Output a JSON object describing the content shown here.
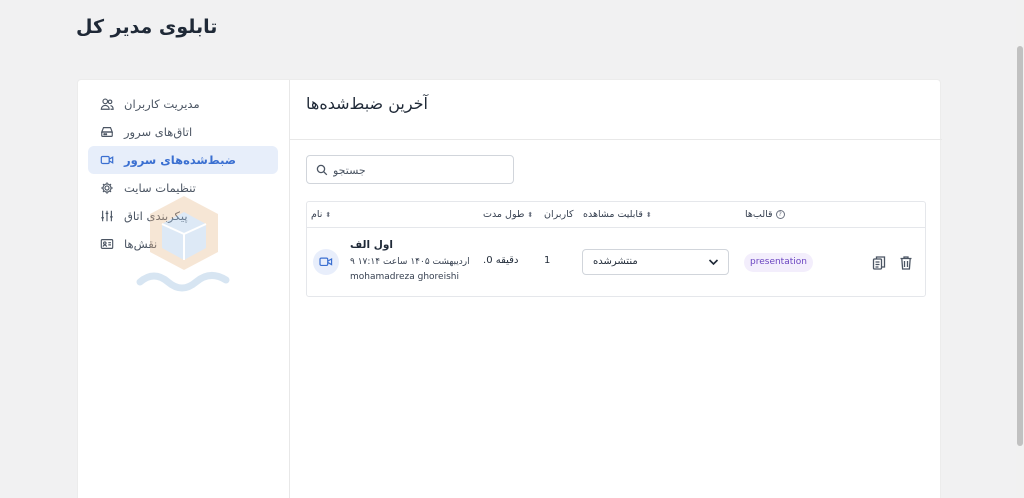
{
  "page": {
    "title": "تابلوی مدیر کل"
  },
  "sidebar": {
    "items": [
      {
        "label": "مدیریت کاربران",
        "icon": "users-icon",
        "active": false
      },
      {
        "label": "اتاق‌های سرور",
        "icon": "server-icon",
        "active": false
      },
      {
        "label": "ضبط‌شده‌های سرور",
        "icon": "video-icon",
        "active": true
      },
      {
        "label": "تنظیمات سایت",
        "icon": "gear-icon",
        "active": false
      },
      {
        "label": "پیکربندی اتاق",
        "icon": "sliders-icon",
        "active": false
      },
      {
        "label": "نقش‌ها",
        "icon": "id-card-icon",
        "active": false
      }
    ]
  },
  "main": {
    "heading": "آخرین ضبط‌شده‌ها",
    "search": {
      "placeholder": "جستجو",
      "value": ""
    },
    "table": {
      "headers": {
        "name": "نام",
        "duration": "طول مدت",
        "users": "کاربران",
        "visibility": "قابلیت مشاهده",
        "formats": "قالب‌ها"
      },
      "rows": [
        {
          "title": "اول الف",
          "date": "اردیبهشت ۱۴۰۵ ساعت ۱۷:۱۴ ۹",
          "user": "mohamadreza ghoreishi",
          "duration": "دقیقه 0.",
          "users": "1",
          "visibility": "منتشرشده",
          "format": "presentation"
        }
      ]
    }
  },
  "colors": {
    "accent": "#3a6fd1",
    "active_bg": "#e7eefa",
    "badge_bg": "#f3eefc",
    "badge_text": "#6b46c1"
  }
}
